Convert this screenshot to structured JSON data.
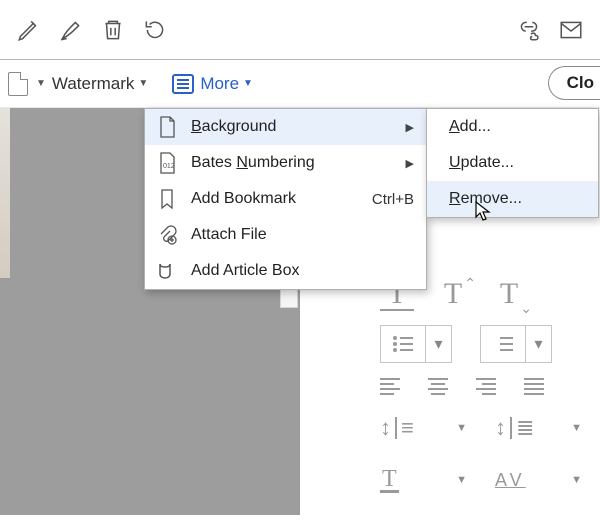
{
  "secondbar": {
    "watermark_label": "Watermark",
    "more_label": "More",
    "close_label": "Clo"
  },
  "more_menu": {
    "items": [
      {
        "label_pre": "",
        "mn": "B",
        "label_post": "ackground",
        "has_sub": true,
        "accel": ""
      },
      {
        "label_pre": "Bates ",
        "mn": "N",
        "label_post": "umbering",
        "has_sub": true,
        "accel": ""
      },
      {
        "label_pre": "Add Bookmark",
        "mn": "",
        "label_post": "",
        "has_sub": false,
        "accel": "Ctrl+B"
      },
      {
        "label_pre": "Attach File",
        "mn": "",
        "label_post": "",
        "has_sub": false,
        "accel": ""
      },
      {
        "label_pre": "Add Article Box",
        "mn": "",
        "label_post": "",
        "has_sub": false,
        "accel": ""
      }
    ]
  },
  "bg_submenu": {
    "items": [
      {
        "mn": "A",
        "rest": "dd..."
      },
      {
        "mn": "U",
        "rest": "pdate..."
      },
      {
        "mn": "R",
        "rest": "emove..."
      }
    ]
  },
  "format_panel": {
    "help": "?",
    "av": "AV"
  }
}
